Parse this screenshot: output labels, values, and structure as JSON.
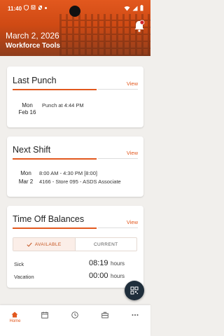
{
  "status_bar": {
    "time": "11:40"
  },
  "header": {
    "date": "March 2, 2026",
    "subtitle": "Workforce Tools"
  },
  "last_punch": {
    "title": "Last Punch",
    "view_label": "View",
    "day": "Mon",
    "date": "Feb 16",
    "detail": "Punch at 4:44 PM"
  },
  "next_shift": {
    "title": "Next Shift",
    "view_label": "View",
    "day": "Mon",
    "date": "Mar 2",
    "time_line": "8:00 AM - 4:30 PM [8:00]",
    "location_line": "4166 - Store 095 - ASDS Associate"
  },
  "time_off": {
    "title": "Time Off Balances",
    "view_label": "View",
    "tab_available": "AVAILABLE",
    "tab_current": "CURRENT",
    "rows": [
      {
        "label": "Sick",
        "value": "08:19",
        "unit": "hours"
      },
      {
        "label": "Vacation",
        "value": "00:00",
        "unit": "hours"
      }
    ]
  },
  "bottom_nav": {
    "home_label": "Home"
  },
  "colors": {
    "accent": "#e2581e",
    "fab": "#1f2e3b"
  }
}
